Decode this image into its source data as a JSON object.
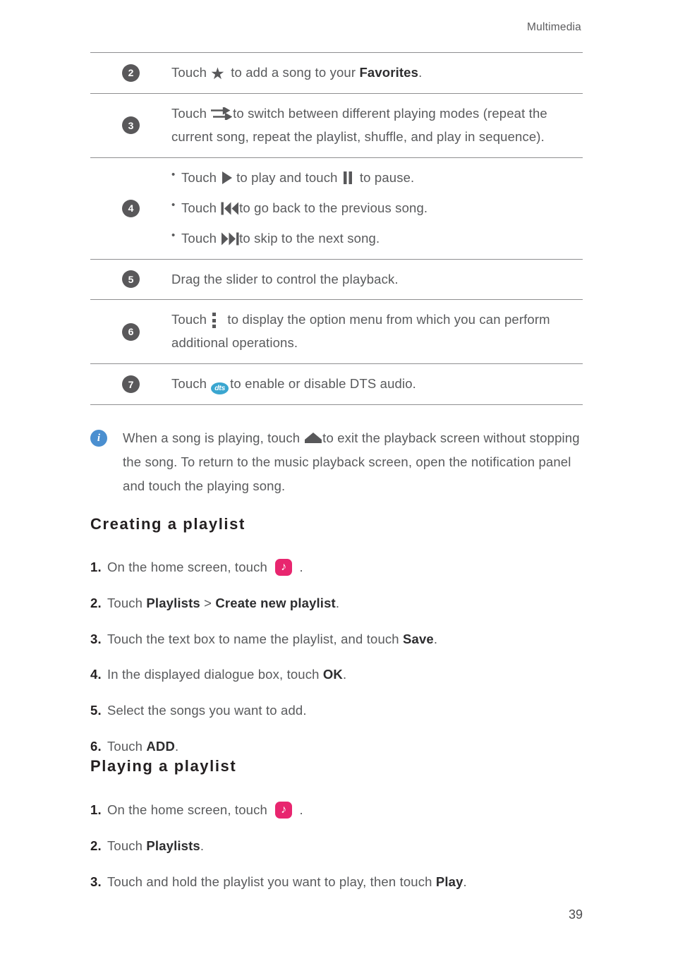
{
  "header": {
    "section_title": "Multimedia"
  },
  "table": {
    "rows": [
      {
        "number": "2",
        "icon": "star-icon",
        "text_before": "Touch",
        "text_after_a": " to add a song to your ",
        "bold": "Favorites",
        "text_end": "."
      },
      {
        "number": "3",
        "icon": "playing-modes-arrows-icon",
        "text_before": "Touch",
        "text_after_a": "to switch between different playing modes (repeat the current song, repeat the playlist, shuffle, and play in sequence)."
      },
      {
        "number": "4",
        "bullets": [
          {
            "pre": "Touch",
            "icon1": "play-icon",
            "mid": "to play and touch",
            "icon2": "pause-icon",
            "post": " to pause."
          },
          {
            "pre": "Touch",
            "icon1": "previous-track-icon",
            "mid": "",
            "post": "to go back to the previous song."
          },
          {
            "pre": "Touch",
            "icon1": "next-track-icon",
            "mid": "",
            "post": "to skip to the next song."
          }
        ]
      },
      {
        "number": "5",
        "text_plain": "Drag the slider to control the playback."
      },
      {
        "number": "6",
        "icon": "overflow-menu-icon",
        "text_before": "Touch",
        "text_after_a": " to display the option menu from which you can perform additional operations."
      },
      {
        "number": "7",
        "icon": "dts-icon",
        "icon_label": "dts",
        "text_before": "Touch",
        "text_after_a": "to enable or disable DTS audio."
      }
    ]
  },
  "note": {
    "icon": "info-icon",
    "icon_glyph": "i",
    "part1": "When a song is playing, touch",
    "icon_inline": "home-icon",
    "part2": "to exit the playback screen without stopping the song. To return to the music playback screen, open the notification panel and touch the playing song."
  },
  "sections": [
    {
      "heading": "Creating  a  playlist",
      "steps": [
        {
          "num": "1.",
          "pre": "On the home screen, touch ",
          "icon": "music-app-icon",
          "post": " ."
        },
        {
          "num": "2.",
          "pre": "Touch ",
          "bold1": "Playlists",
          "sep": " > ",
          "bold2": "Create new playlist",
          "post": "."
        },
        {
          "num": "3.",
          "pre": "Touch the text box to name the playlist, and touch ",
          "bold1": "Save",
          "post": "."
        },
        {
          "num": "4.",
          "pre": "In the displayed dialogue box, touch ",
          "bold1": "OK",
          "post": "."
        },
        {
          "num": "5.",
          "pre": "Select the songs you want to add.",
          "post": ""
        },
        {
          "num": "6.",
          "pre": "Touch ",
          "bold1": "ADD",
          "post": "."
        }
      ]
    },
    {
      "heading": "Playing  a  playlist",
      "steps": [
        {
          "num": "1.",
          "pre": "On the home screen, touch ",
          "icon": "music-app-icon",
          "post": " ."
        },
        {
          "num": "2.",
          "pre": "Touch ",
          "bold1": "Playlists",
          "post": "."
        },
        {
          "num": "3.",
          "pre": "Touch and hold the playlist you want to play, then touch ",
          "bold1": "Play",
          "post": "."
        }
      ]
    }
  ],
  "footer": {
    "page_number": "39"
  },
  "colors": {
    "rule": "#8e8e90",
    "badge": "#59585a",
    "body_text": "#595a5c",
    "bold_text": "#231f20",
    "dts_blue": "#3aa6d0",
    "info_blue": "#4a8fd0",
    "music_pink": "#e8266f"
  }
}
